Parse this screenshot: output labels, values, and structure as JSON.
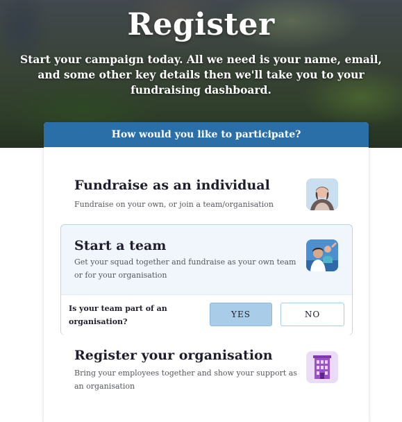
{
  "hero": {
    "title": "Register",
    "subtitle": "Start your campaign today. All we need is your name, email, and some other key details then we'll take you to your fundraising dashboard."
  },
  "card": {
    "header": "How would you like to participate?"
  },
  "options": {
    "individual": {
      "title": "Fundraise as an individual",
      "description": "Fundraise on your own, or join a team/organisation",
      "icon": "person-photo-icon"
    },
    "team": {
      "title": "Start a team",
      "description": "Get your squad together and fundraise as your own team or for your organisation",
      "icon": "team-photo-icon",
      "selected": true,
      "question": "Is your team part of an organisation?",
      "yes_label": "YES",
      "no_label": "NO",
      "answer": "YES"
    },
    "organisation": {
      "title": "Register your organisation",
      "description": "Bring your employees together and show your support as an organisation",
      "icon": "building-icon"
    }
  },
  "colors": {
    "header_blue": "#2a6fa8",
    "selected_bg": "#f0f6fc",
    "yes_selected": "#a9cde9",
    "building_purple": "#9b52c9"
  }
}
